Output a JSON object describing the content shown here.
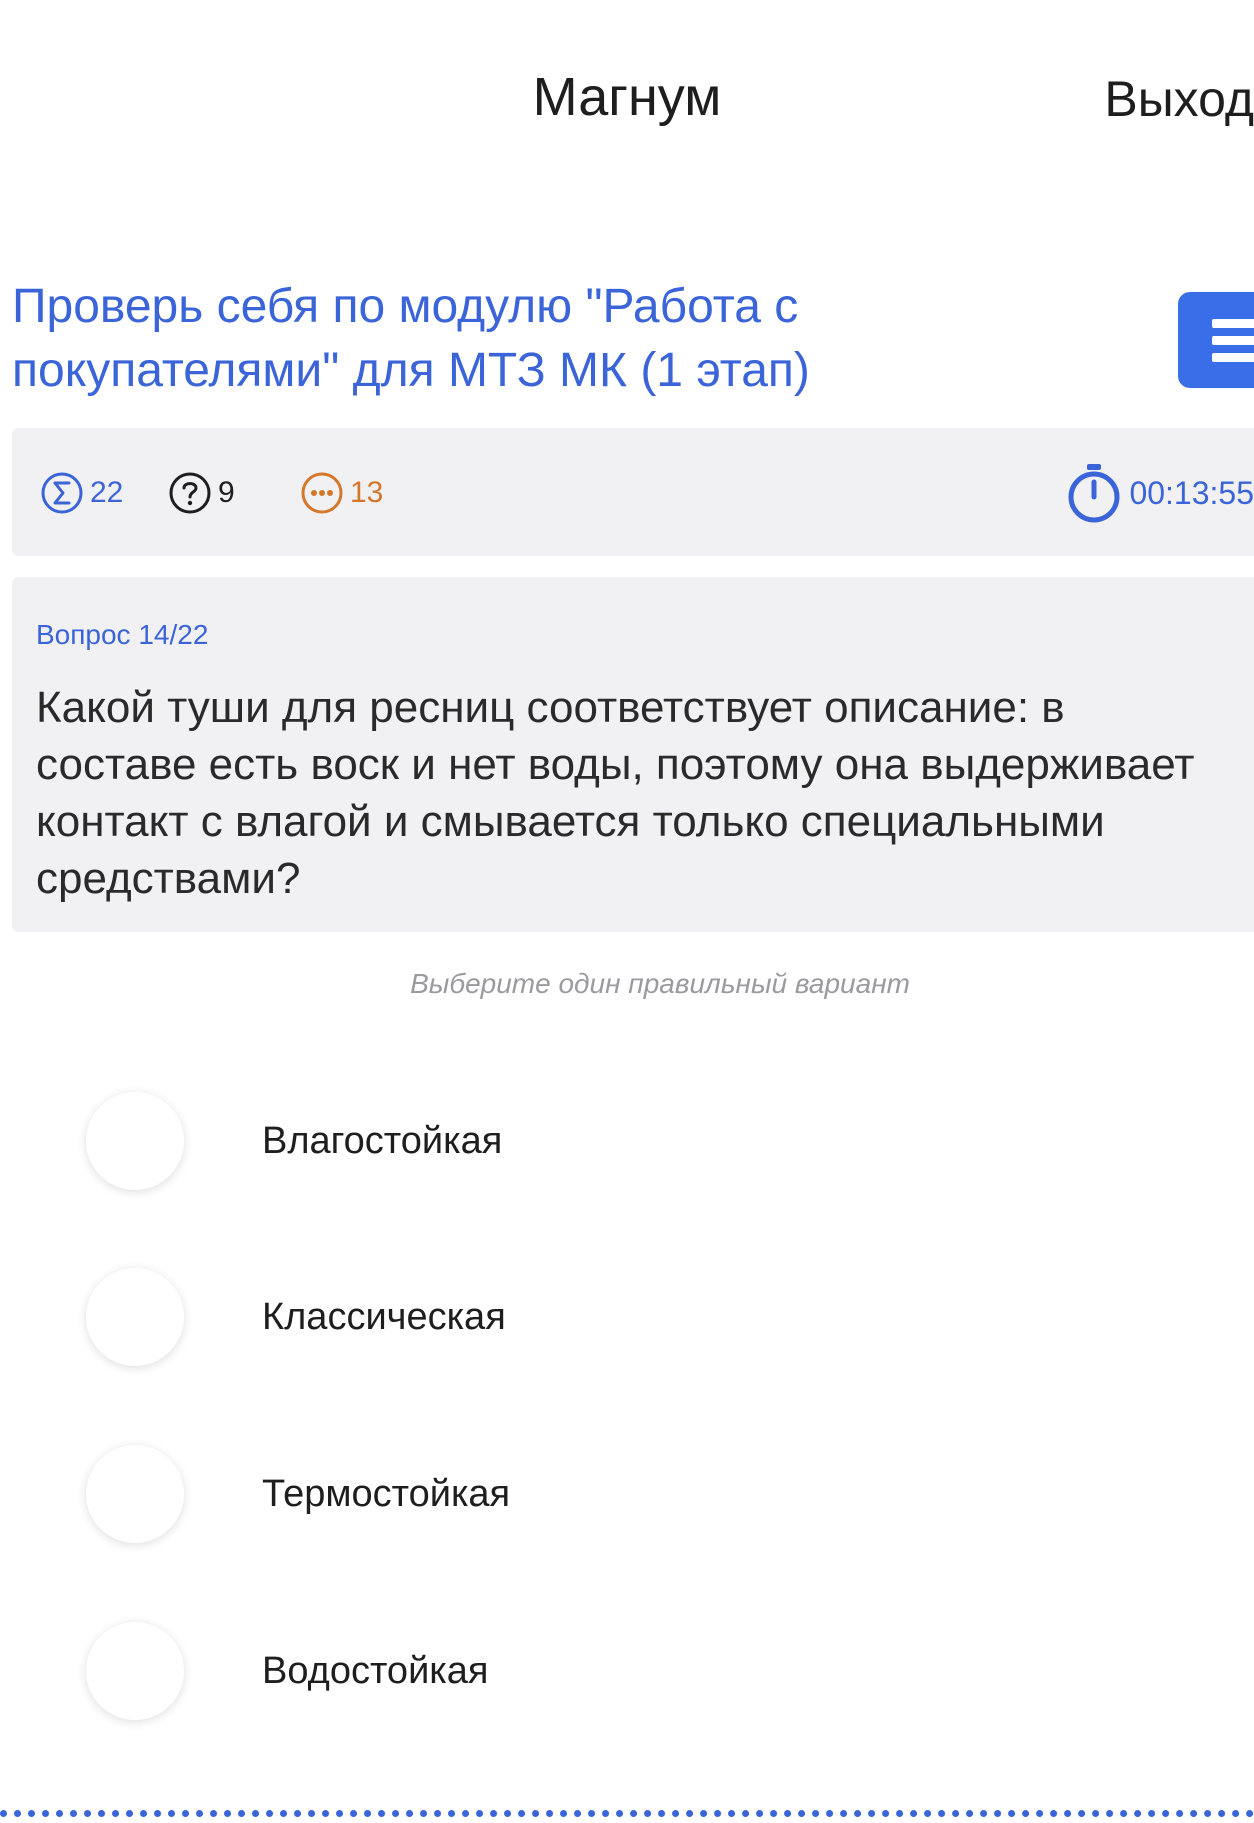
{
  "header": {
    "app_title": "Магнум",
    "exit_label": "Выход"
  },
  "test": {
    "title": "Проверь себя по модулю \"Работа с покупателями\" для МТЗ МК (1 этап)",
    "menu_icon": "hamburger-menu-icon"
  },
  "stats": {
    "total": "22",
    "unanswered": "9",
    "remaining": "13",
    "timer": "00:13:55",
    "icons": {
      "total": "sigma-icon",
      "unanswered": "question-circle-icon",
      "remaining": "ellipsis-circle-icon",
      "timer": "stopwatch-icon"
    }
  },
  "question": {
    "number_label": "Вопрос 14/22",
    "text": "Какой туши для ресниц соответствует описание: в составе есть воск и нет воды, поэтому она выдерживает контакт с влагой и смывается только специальными средствами?",
    "hint": "Выберите один правильный вариант"
  },
  "options": [
    {
      "label": "Влагостойкая"
    },
    {
      "label": "Классическая"
    },
    {
      "label": "Термостойкая"
    },
    {
      "label": "Водостойкая"
    }
  ],
  "colors": {
    "accent": "#3a64d8",
    "menu_button": "#3a6ee8",
    "remaining": "#d5772a",
    "panel_bg": "#f1f1f3",
    "hint": "#9a9aa0"
  }
}
